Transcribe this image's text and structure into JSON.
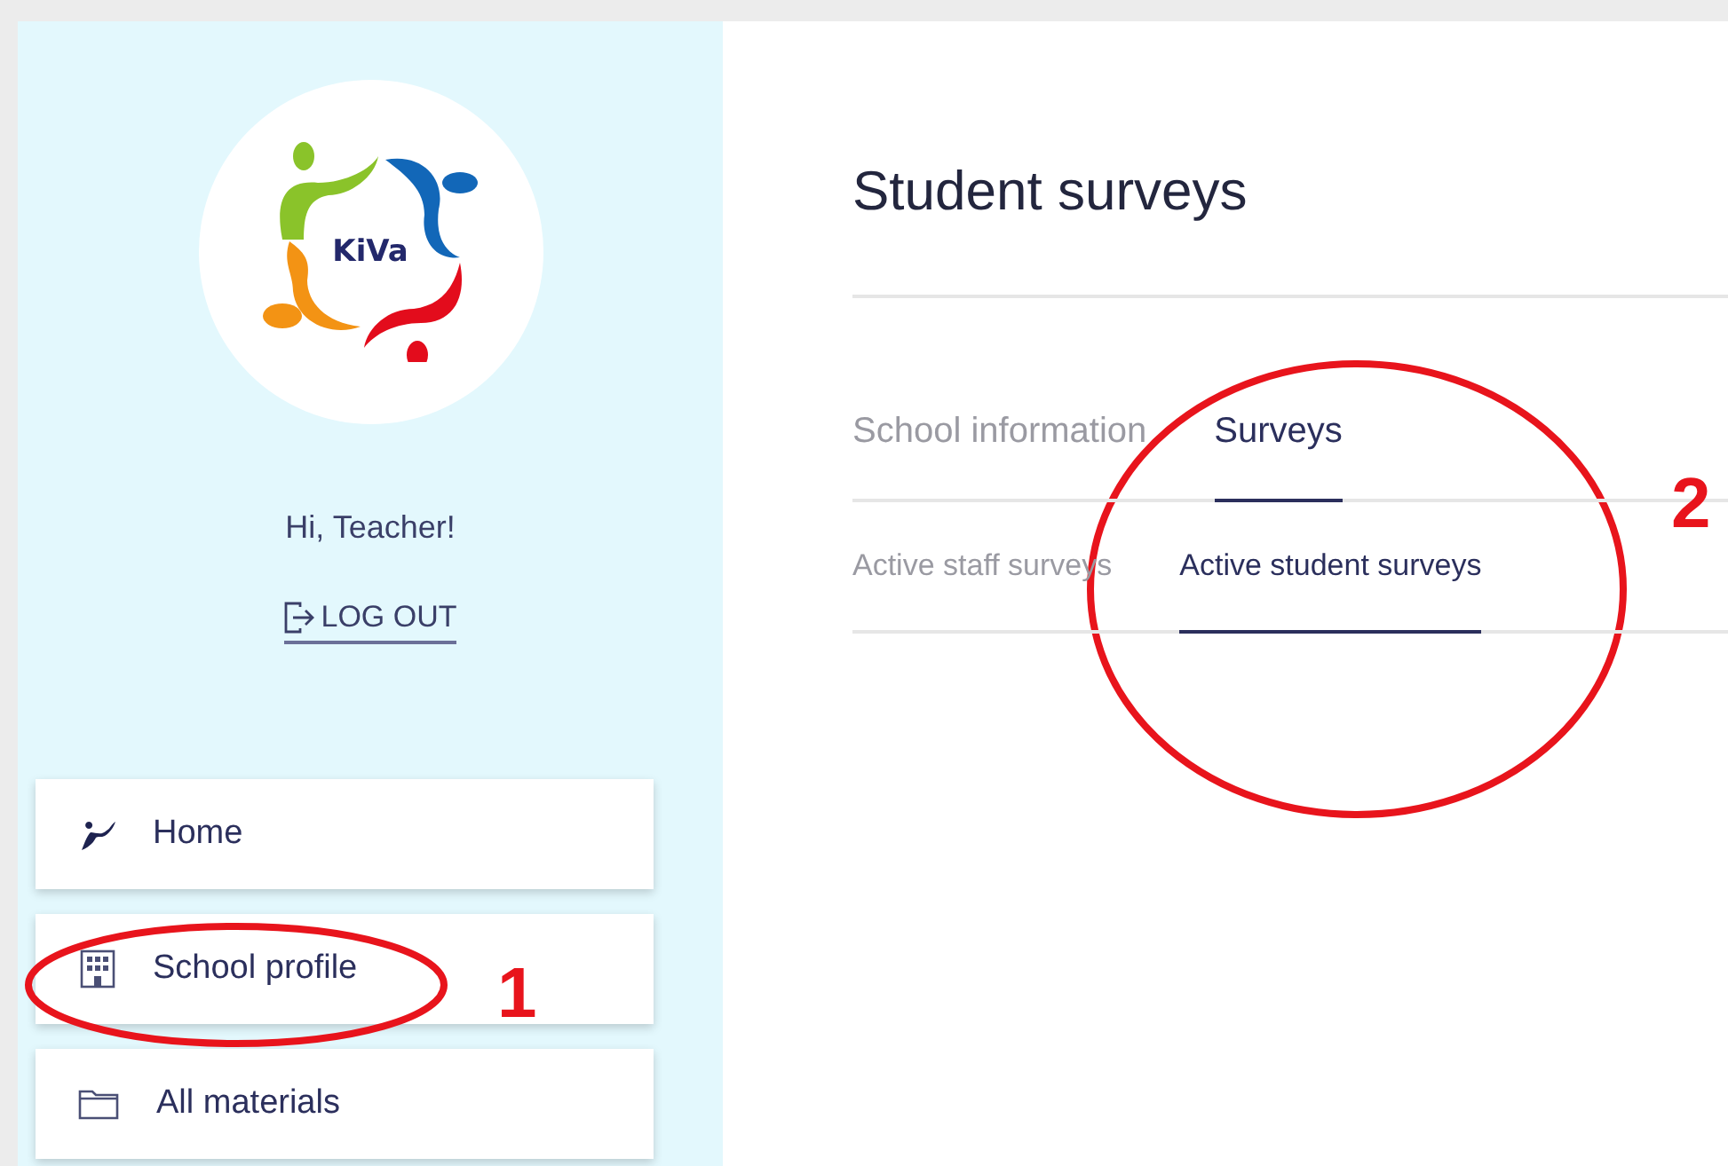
{
  "sidebar": {
    "logo": {
      "text": "KiVa"
    },
    "greeting": "Hi, Teacher!",
    "logout": "LOG OUT",
    "items": [
      {
        "label": "Home"
      },
      {
        "label": "School profile"
      },
      {
        "label": "All materials"
      }
    ]
  },
  "main": {
    "title": "Student surveys",
    "tabs": [
      {
        "label": "School information",
        "selected": false
      },
      {
        "label": "Surveys",
        "selected": true
      }
    ],
    "subtabs": [
      {
        "label": "Active staff surveys",
        "selected": false
      },
      {
        "label": "Active student surveys",
        "selected": true
      }
    ]
  },
  "annotations": [
    {
      "label": "1"
    },
    {
      "label": "2"
    }
  ]
}
